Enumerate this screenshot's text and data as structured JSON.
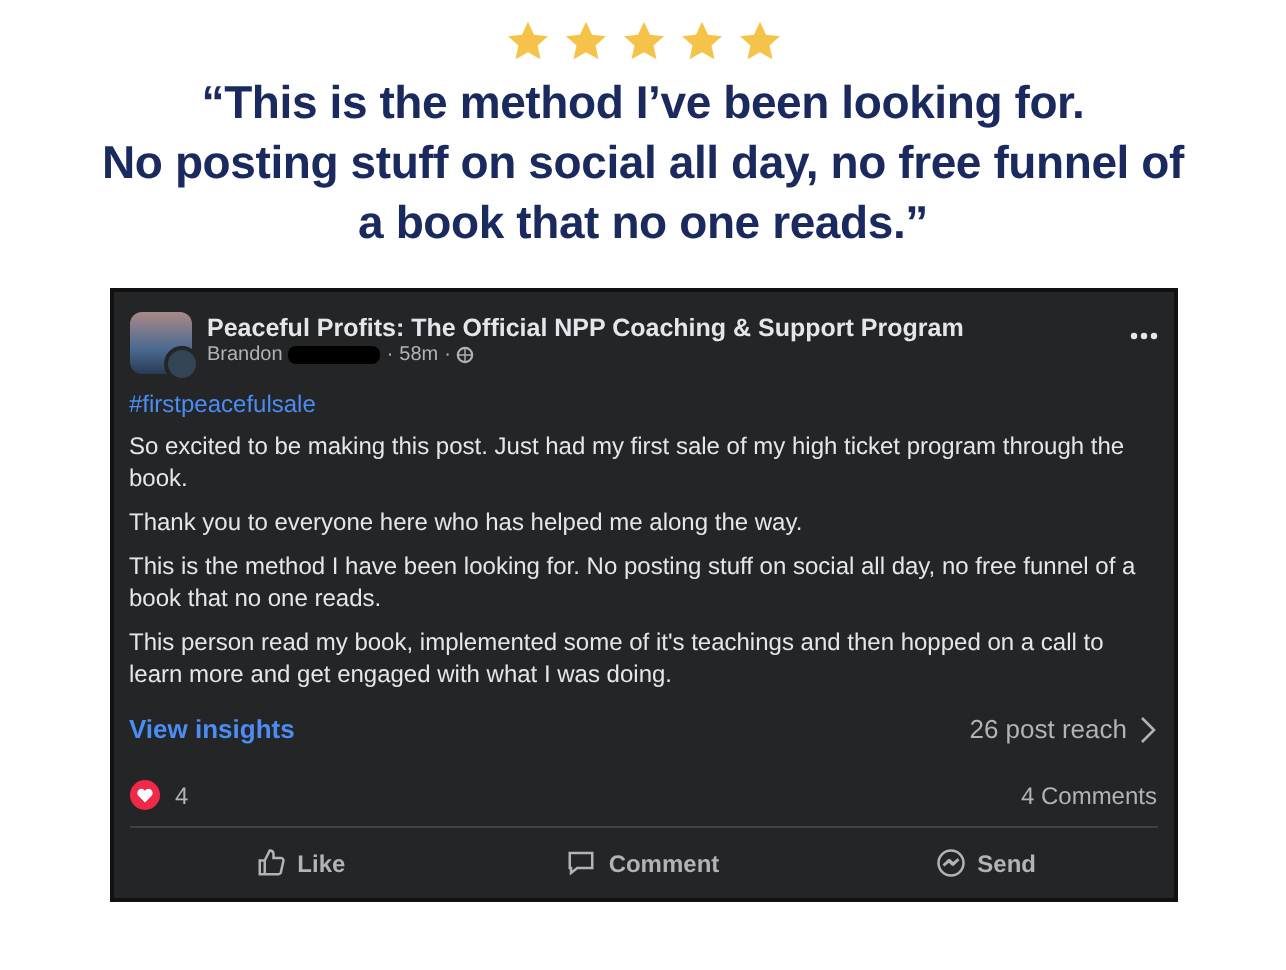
{
  "rating": {
    "stars": 5
  },
  "quote": {
    "lines": [
      "“This is the method I’ve been looking for.",
      "No posting stuff on social all day, no free funnel of",
      "a book that no one reads.”"
    ]
  },
  "post": {
    "group": "Peaceful Profits: The Official NPP Coaching & Support Program",
    "author": "Brandon",
    "redacted": true,
    "separator": "·",
    "time": "58m",
    "hashtag": "#firstpeacefulsale",
    "paragraphs": [
      "So excited to be making this post. Just had my first sale of my high ticket program through the book.",
      "Thank you to everyone here who has helped me along the way.",
      "This is the method I have been looking for. No posting stuff on social all day, no free funnel of a book that no one reads.",
      "This person read my book, implemented some of it's teachings and then hopped on a call to learn more and get engaged with what I was doing."
    ],
    "insights_link": "View insights",
    "reach": "26 post reach",
    "reactions": "4",
    "comments": "4 Comments",
    "actions": [
      {
        "kind": "like",
        "label": "Like"
      },
      {
        "kind": "comment",
        "label": "Comment"
      },
      {
        "kind": "send",
        "label": "Send"
      }
    ]
  }
}
